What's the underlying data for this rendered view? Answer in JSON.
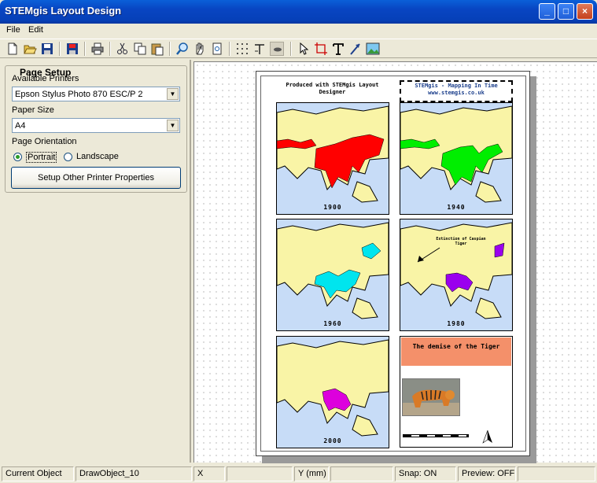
{
  "window": {
    "title": "STEMgis Layout Design"
  },
  "menu": [
    "File",
    "Edit"
  ],
  "toolbar_icons": [
    "new-icon",
    "open-icon",
    "save-icon",
    "save-as-icon",
    "print-icon",
    "cut-icon",
    "copy-icon",
    "paste-icon",
    "zoom-icon",
    "pan-icon",
    "zoom-page-icon",
    "grid-icon",
    "snap-icon",
    "preview-icon",
    "select-icon",
    "crop-icon",
    "text-icon",
    "arrow-icon",
    "image-icon"
  ],
  "page_setup": {
    "title": "Page Setup",
    "printers_label": "Available Printers",
    "printer_value": "Epson Stylus Photo 870 ESC/P 2",
    "paper_label": "Paper Size",
    "paper_value": "A4",
    "orientation_label": "Page Orientation",
    "portrait_label": "Portrait",
    "landscape_label": "Landscape",
    "orientation_selected": "Portrait",
    "button_label": "Setup Other Printer Properties"
  },
  "layout": {
    "header_left": "Produced with STEMgis Layout Designer",
    "header_right_line1": "STEMgis - Mapping In Time",
    "header_right_line2": "www.stemgis.co.uk",
    "maps": [
      {
        "year": "1900",
        "color": "#ff0000"
      },
      {
        "year": "1940",
        "color": "#00ee00"
      },
      {
        "year": "1960",
        "color": "#00e5ee"
      },
      {
        "year": "1980",
        "color": "#9a00ee"
      },
      {
        "year": "2000",
        "color": "#dd00dd"
      }
    ],
    "annotation": "Extinction of Caspian Tiger",
    "info_title": "The demise of the Tiger"
  },
  "status": {
    "current_object_label": "Current Object",
    "current_object_value": "DrawObject_10",
    "x_label": "X (mm)",
    "x_value": "",
    "y_label": "Y (mm)",
    "y_value": "",
    "snap": "Snap: ON",
    "preview": "Preview: OFF"
  }
}
